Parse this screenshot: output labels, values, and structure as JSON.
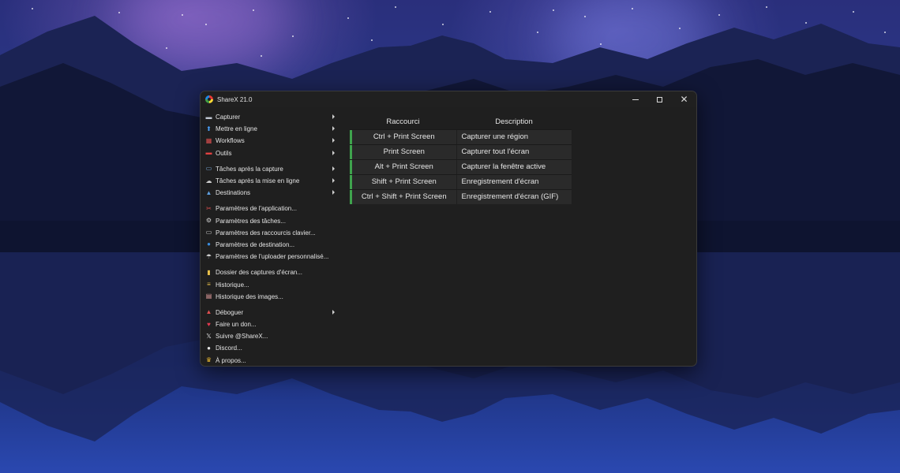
{
  "window": {
    "title": "ShareX 21.0"
  },
  "menu": {
    "groups": [
      [
        {
          "label": "Capturer",
          "icon": "camera-icon",
          "submenu": true
        },
        {
          "label": "Mettre en ligne",
          "icon": "upload-arrow-icon",
          "submenu": true
        },
        {
          "label": "Workflows",
          "icon": "grid-icon",
          "submenu": true
        },
        {
          "label": "Outils",
          "icon": "toolbox-icon",
          "submenu": true
        }
      ],
      [
        {
          "label": "Tâches après la capture",
          "icon": "image-task-icon",
          "submenu": true
        },
        {
          "label": "Tâches après la mise en ligne",
          "icon": "cloud-icon",
          "submenu": true
        },
        {
          "label": "Destinations",
          "icon": "destination-icon",
          "submenu": true
        }
      ],
      [
        {
          "label": "Paramètres de l'application...",
          "icon": "tools-icon",
          "submenu": false
        },
        {
          "label": "Paramètres des tâches...",
          "icon": "gear-icon",
          "submenu": false
        },
        {
          "label": "Paramètres des raccourcis clavier...",
          "icon": "keyboard-icon",
          "submenu": false
        },
        {
          "label": "Paramètres de destination...",
          "icon": "globe-icon",
          "submenu": false
        },
        {
          "label": "Paramètres de l'uploader personnalisé...",
          "icon": "umbrella-icon",
          "submenu": false
        }
      ],
      [
        {
          "label": "Dossier des captures d'écran...",
          "icon": "folder-icon",
          "submenu": false
        },
        {
          "label": "Historique...",
          "icon": "history-icon",
          "submenu": false
        },
        {
          "label": "Historique des images...",
          "icon": "images-icon",
          "submenu": false
        }
      ],
      [
        {
          "label": "Déboguer",
          "icon": "bug-icon",
          "submenu": true
        },
        {
          "label": "Faire un don...",
          "icon": "heart-icon",
          "submenu": false
        },
        {
          "label": "Suivre @ShareX...",
          "icon": "x-logo-icon",
          "submenu": false
        },
        {
          "label": "Discord...",
          "icon": "discord-icon",
          "submenu": false
        },
        {
          "label": "À propos...",
          "icon": "crown-icon",
          "submenu": false
        }
      ]
    ]
  },
  "hotkeys": {
    "headers": {
      "key": "Raccourci",
      "desc": "Description"
    },
    "rows": [
      {
        "key": "Ctrl + Print Screen",
        "desc": "Capturer une région"
      },
      {
        "key": "Print Screen",
        "desc": "Capturer tout l'écran"
      },
      {
        "key": "Alt + Print Screen",
        "desc": "Capturer la fenêtre active"
      },
      {
        "key": "Shift + Print Screen",
        "desc": "Enregistrement d'écran"
      },
      {
        "key": "Ctrl + Shift + Print Screen",
        "desc": "Enregistrement d'écran (GIF)"
      }
    ],
    "accent": "#3fa34d"
  }
}
